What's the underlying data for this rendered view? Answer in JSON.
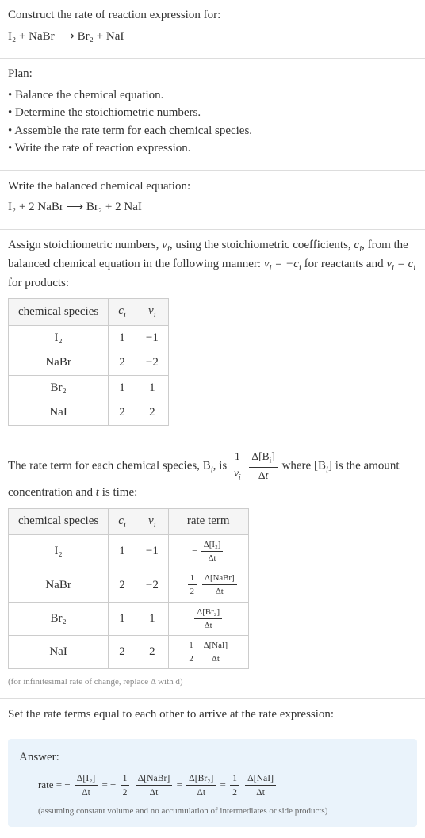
{
  "intro": {
    "prompt": "Construct the rate of reaction expression for:",
    "equation": "I₂ + NaBr ⟶ Br₂ + NaI"
  },
  "plan": {
    "heading": "Plan:",
    "items": [
      "Balance the chemical equation.",
      "Determine the stoichiometric numbers.",
      "Assemble the rate term for each chemical species.",
      "Write the rate of reaction expression."
    ]
  },
  "balanced": {
    "heading": "Write the balanced chemical equation:",
    "equation": "I₂ + 2 NaBr ⟶ Br₂ + 2 NaI"
  },
  "stoich": {
    "heading_before": "Assign stoichiometric numbers, ",
    "heading_mid1": ", using the stoichiometric coefficients, ",
    "heading_mid2": ", from the balanced chemical equation in the following manner: ",
    "rule_reactants": " for reactants and ",
    "rule_products": " for products:",
    "table": {
      "headers": [
        "chemical species",
        "cᵢ",
        "νᵢ"
      ],
      "rows": [
        {
          "species": "I₂",
          "c": "1",
          "nu": "−1"
        },
        {
          "species": "NaBr",
          "c": "2",
          "nu": "−2"
        },
        {
          "species": "Br₂",
          "c": "1",
          "nu": "1"
        },
        {
          "species": "NaI",
          "c": "2",
          "nu": "2"
        }
      ]
    }
  },
  "rateterm": {
    "text_before": "The rate term for each chemical species, B",
    "text_mid1": ", is ",
    "text_mid2": " where [B",
    "text_mid3": "] is the amount concentration and ",
    "text_after": " is time:",
    "table": {
      "headers": [
        "chemical species",
        "cᵢ",
        "νᵢ",
        "rate term"
      ],
      "rows": [
        {
          "species": "I₂",
          "c": "1",
          "nu": "−1",
          "num": "Δ[I₂]",
          "den": "Δt",
          "prefix": "−",
          "half": false
        },
        {
          "species": "NaBr",
          "c": "2",
          "nu": "−2",
          "num": "Δ[NaBr]",
          "den": "Δt",
          "prefix": "−",
          "half": true
        },
        {
          "species": "Br₂",
          "c": "1",
          "nu": "1",
          "num": "Δ[Br₂]",
          "den": "Δt",
          "prefix": "",
          "half": false
        },
        {
          "species": "NaI",
          "c": "2",
          "nu": "2",
          "num": "Δ[NaI]",
          "den": "Δt",
          "prefix": "",
          "half": true
        }
      ]
    },
    "note": "(for infinitesimal rate of change, replace Δ with d)"
  },
  "final": {
    "heading": "Set the rate terms equal to each other to arrive at the rate expression:"
  },
  "answer": {
    "label": "Answer:",
    "rate_label": "rate = ",
    "note": "(assuming constant volume and no accumulation of intermediates or side products)"
  },
  "chart_data": {
    "type": "table",
    "title": "Stoichiometric numbers and rate terms",
    "tables": [
      {
        "columns": [
          "chemical species",
          "c_i",
          "ν_i"
        ],
        "rows": [
          [
            "I₂",
            1,
            -1
          ],
          [
            "NaBr",
            2,
            -2
          ],
          [
            "Br₂",
            1,
            1
          ],
          [
            "NaI",
            2,
            2
          ]
        ]
      },
      {
        "columns": [
          "chemical species",
          "c_i",
          "ν_i",
          "rate term"
        ],
        "rows": [
          [
            "I₂",
            1,
            -1,
            "-Δ[I₂]/Δt"
          ],
          [
            "NaBr",
            2,
            -2,
            "-(1/2) Δ[NaBr]/Δt"
          ],
          [
            "Br₂",
            1,
            1,
            "Δ[Br₂]/Δt"
          ],
          [
            "NaI",
            2,
            2,
            "(1/2) Δ[NaI]/Δt"
          ]
        ]
      }
    ],
    "rate_expression": "rate = -Δ[I₂]/Δt = -(1/2) Δ[NaBr]/Δt = Δ[Br₂]/Δt = (1/2) Δ[NaI]/Δt"
  }
}
